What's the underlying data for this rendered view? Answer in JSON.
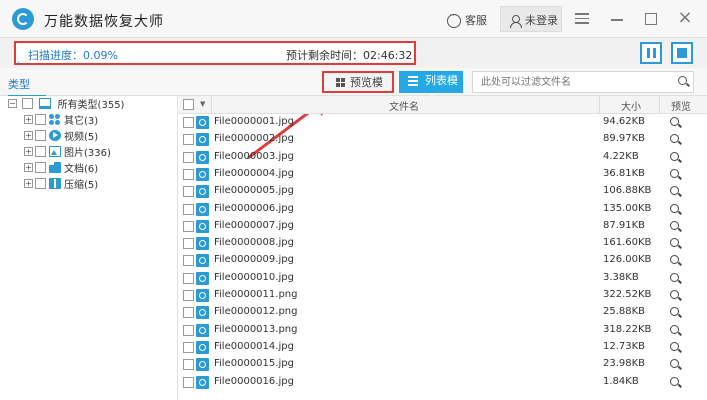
{
  "app": {
    "title": "万能数据恢复大师"
  },
  "titlebar": {
    "help_label": "客服",
    "login_label": "未登录"
  },
  "scan": {
    "progress_label": "扫描进度：0.09%",
    "progress_fraction": 0.0009,
    "remaining_label": "预计剩余时间：02:46:32"
  },
  "toolbar": {
    "type_tab": "类型",
    "preview_mode": "预览模式",
    "list_mode": "列表模式",
    "filter_placeholder": "此处可以过滤文件名"
  },
  "tree": {
    "root": "所有类型(355)",
    "items": [
      {
        "label": "其它(3)",
        "icon": "other-icon"
      },
      {
        "label": "视频(5)",
        "icon": "video-icon"
      },
      {
        "label": "图片(336)",
        "icon": "picture-icon"
      },
      {
        "label": "文档(6)",
        "icon": "document-icon"
      },
      {
        "label": "压缩(5)",
        "icon": "zip-icon"
      }
    ]
  },
  "table": {
    "columns": {
      "name": "文件名",
      "size": "大小",
      "preview": "预览"
    },
    "rows": [
      {
        "name": "File0000001.jpg",
        "size": "94.62KB"
      },
      {
        "name": "File0000002.jpg",
        "size": "89.97KB"
      },
      {
        "name": "File0000003.jpg",
        "size": "4.22KB"
      },
      {
        "name": "File0000004.jpg",
        "size": "36.81KB"
      },
      {
        "name": "File0000005.jpg",
        "size": "106.88KB"
      },
      {
        "name": "File0000006.jpg",
        "size": "135.00KB"
      },
      {
        "name": "File0000007.jpg",
        "size": "87.91KB"
      },
      {
        "name": "File0000008.jpg",
        "size": "161.60KB"
      },
      {
        "name": "File0000009.jpg",
        "size": "126.00KB"
      },
      {
        "name": "File0000010.jpg",
        "size": "3.38KB"
      },
      {
        "name": "File0000011.png",
        "size": "322.52KB"
      },
      {
        "name": "File0000012.png",
        "size": "25.88KB"
      },
      {
        "name": "File0000013.png",
        "size": "318.22KB"
      },
      {
        "name": "File0000014.jpg",
        "size": "12.73KB"
      },
      {
        "name": "File0000015.jpg",
        "size": "23.98KB"
      },
      {
        "name": "File0000016.jpg",
        "size": "1.84KB"
      }
    ]
  },
  "colors": {
    "accent": "#2b9bd6",
    "highlight": "#e03c3c",
    "list_mode_bg": "#25a9e6"
  }
}
